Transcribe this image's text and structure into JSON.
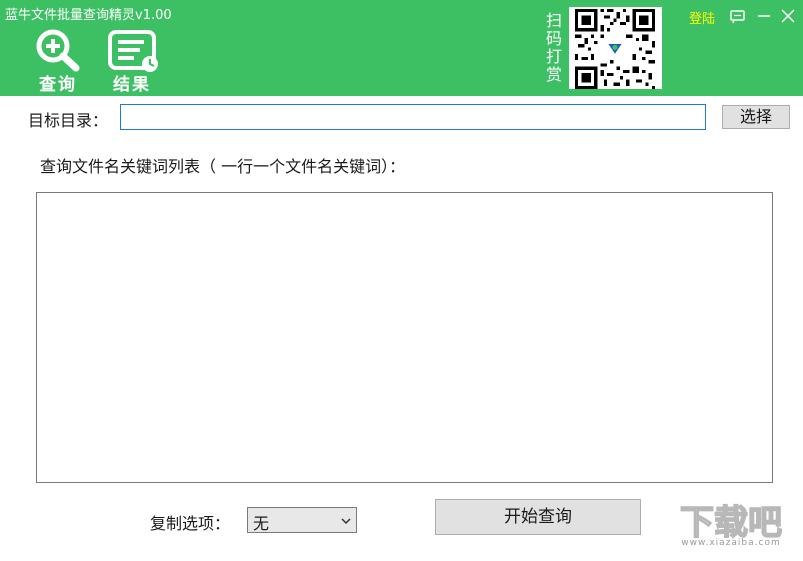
{
  "app": {
    "title": "蓝牛文件批量查询精灵v1.00"
  },
  "toolbar": {
    "search_label": "查询",
    "results_label": "结果"
  },
  "donate": {
    "text": [
      "扫",
      "码",
      "打",
      "赏"
    ]
  },
  "window": {
    "login_label": "登陆"
  },
  "form": {
    "target_label": "目标目录：",
    "target_value": "",
    "select_button": "选择",
    "keywords_label": "查询文件名关键词列表（ 一行一个文件名关键词）：",
    "keywords_value": "",
    "copy_label": "复制选项：",
    "copy_selected": "无",
    "start_button": "开始查询"
  },
  "watermark": {
    "brand": "下载吧",
    "site": "www.xiazaiba.com"
  },
  "colors": {
    "header_green": "#3dc064",
    "login_yellow": "#ffff00",
    "input_border": "#1e7bd0"
  }
}
